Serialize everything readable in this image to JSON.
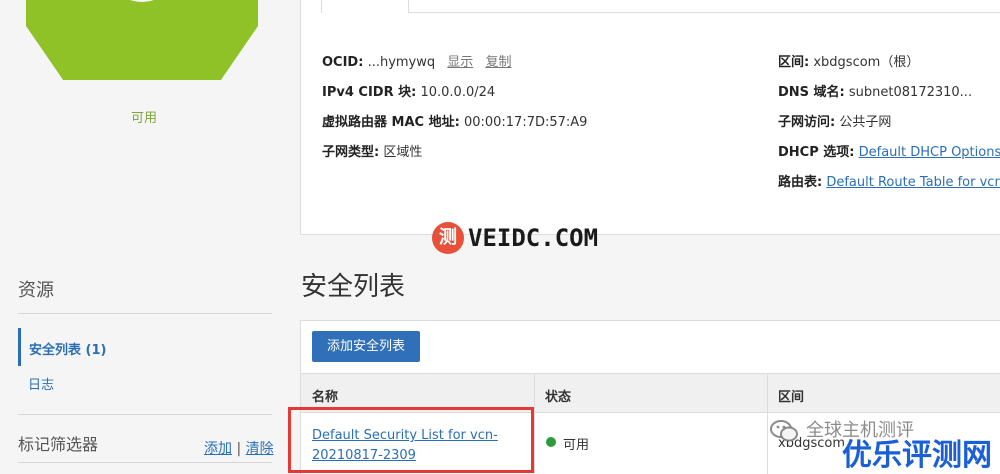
{
  "resource_state": {
    "label": "可用",
    "color": "#8fc226"
  },
  "details": {
    "ocid": {
      "label": "OCID:",
      "value": "...hymywq",
      "show_link": "显示",
      "copy_link": "复制"
    },
    "ipv4": {
      "label": "IPv4 CIDR 块:",
      "value": "10.0.0.0/24"
    },
    "mac": {
      "label": "虚拟路由器 MAC 地址:",
      "value": "00:00:17:7D:57:A9"
    },
    "subnet_type": {
      "label": "子网类型:",
      "value": "区域性"
    },
    "compartment": {
      "label": "区间:",
      "value": "xbdgscom（根）"
    },
    "dns": {
      "label": "DNS 域名:",
      "value": "subnet08172310..."
    },
    "subnet_access": {
      "label": "子网访问:",
      "value": "公共子网"
    },
    "dhcp": {
      "label": "DHCP 选项:",
      "value": "Default DHCP Options"
    },
    "route_table": {
      "label": "路由表:",
      "value": "Default Route Table for vcn"
    }
  },
  "sidebar": {
    "resources_title": "资源",
    "items": [
      {
        "label": "安全列表 (1)",
        "active": true
      },
      {
        "label": "日志",
        "active": false
      }
    ],
    "tag_filter_title": "标记筛选器",
    "tag_add": "添加",
    "tag_sep": "|",
    "tag_clear": "清除"
  },
  "security_lists": {
    "title": "安全列表",
    "add_button": "添加安全列表",
    "columns": [
      "名称",
      "状态",
      "区间"
    ],
    "rows": [
      {
        "name": "Default Security List for vcn-20210817-2309",
        "status": "可用",
        "status_color": "#2e9a3d",
        "compartment": "xbdgscom"
      }
    ]
  },
  "watermarks": {
    "veidc_badge": "测",
    "veidc_text": "VEIDC.COM",
    "wechat_text": "全球主机测评",
    "site_text": "优乐评测网"
  }
}
